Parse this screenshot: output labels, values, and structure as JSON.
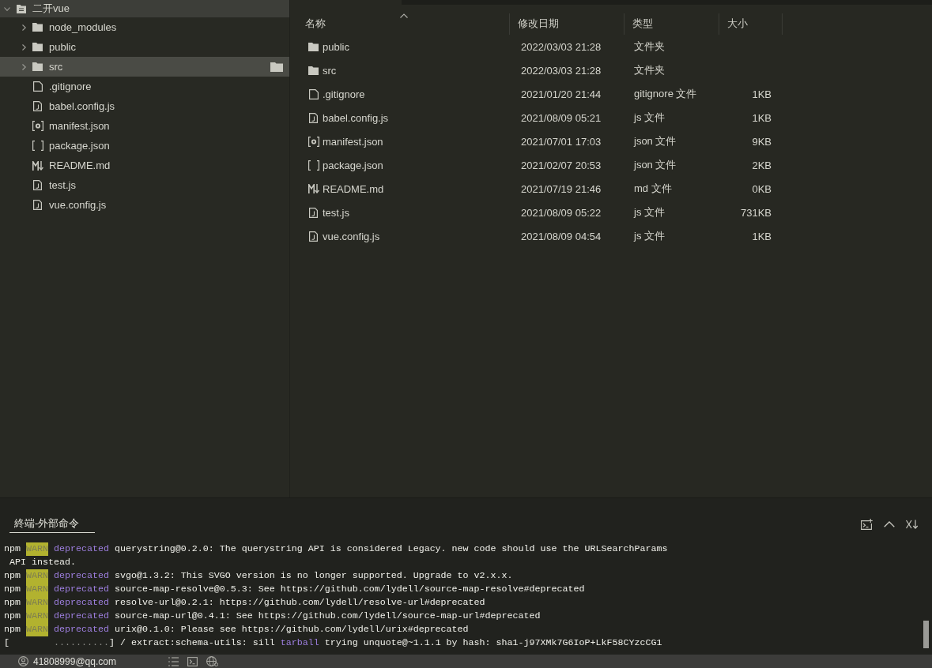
{
  "explorer": {
    "root": {
      "label": "二开vue",
      "expanded": true,
      "children": [
        {
          "name": "node_modules",
          "kind": "folder",
          "expanded": false,
          "selected": false
        },
        {
          "name": "public",
          "kind": "folder",
          "expanded": false,
          "selected": false
        },
        {
          "name": "src",
          "kind": "folder",
          "expanded": false,
          "selected": true
        },
        {
          "name": ".gitignore",
          "kind": "file",
          "selected": false
        },
        {
          "name": "babel.config.js",
          "kind": "script",
          "selected": false
        },
        {
          "name": "manifest.json",
          "kind": "settings",
          "selected": false
        },
        {
          "name": "package.json",
          "kind": "brackets",
          "selected": false
        },
        {
          "name": "README.md",
          "kind": "markdown",
          "selected": false
        },
        {
          "name": "test.js",
          "kind": "script",
          "selected": false
        },
        {
          "name": "vue.config.js",
          "kind": "script",
          "selected": false
        }
      ]
    }
  },
  "file_list": {
    "columns": [
      {
        "label": "名称",
        "sorted": true
      },
      {
        "label": "修改日期",
        "sorted": false
      },
      {
        "label": "类型",
        "sorted": false
      },
      {
        "label": "大小",
        "sorted": false
      }
    ],
    "rows": [
      {
        "name": "public",
        "kind": "folder",
        "modified": "2022/03/03 21:28",
        "type": "文件夹"
      },
      {
        "name": "src",
        "kind": "folder",
        "modified": "2022/03/03 21:28",
        "type": "文件夹"
      },
      {
        "name": ".gitignore",
        "kind": "file",
        "modified": "2021/01/20 21:44",
        "type": "gitignore 文件",
        "size": "1KB"
      },
      {
        "name": "babel.config.js",
        "kind": "script",
        "modified": "2021/08/09 05:21",
        "type": "js 文件",
        "size": "1KB"
      },
      {
        "name": "manifest.json",
        "kind": "settings",
        "modified": "2021/07/01 17:03",
        "type": "json 文件",
        "size": "9KB"
      },
      {
        "name": "package.json",
        "kind": "brackets",
        "modified": "2021/02/07 20:53",
        "type": "json 文件",
        "size": "2KB"
      },
      {
        "name": "README.md",
        "kind": "markdown",
        "modified": "2021/07/19 21:46",
        "type": "md 文件",
        "size": "0KB"
      },
      {
        "name": "test.js",
        "kind": "script",
        "modified": "2021/08/09 05:22",
        "type": "js 文件",
        "size": "731KB"
      },
      {
        "name": "vue.config.js",
        "kind": "script",
        "modified": "2021/08/09 04:54",
        "type": "js 文件",
        "size": "1KB"
      }
    ]
  },
  "terminal": {
    "tab": {
      "label": "終端-外部命令",
      "selected": true
    },
    "lines": [
      {
        "segments": [
          {
            "kind": "plain",
            "text": "npm "
          },
          {
            "kind": "badge",
            "text": "WARN"
          },
          {
            "kind": "keyword",
            "text": " deprecated"
          },
          {
            "kind": "plain",
            "text": " querystring@0.2.0: The querystring API is considered Legacy. new code should use the URLSearchParams"
          }
        ]
      },
      {
        "segments": [
          {
            "kind": "plain",
            "text": " API instead."
          }
        ]
      },
      {
        "segments": [
          {
            "kind": "plain",
            "text": "npm "
          },
          {
            "kind": "badge",
            "text": "WARN"
          },
          {
            "kind": "keyword",
            "text": " deprecated"
          },
          {
            "kind": "plain",
            "text": " svgo@1.3.2: This SVGO version is no longer supported. Upgrade to v2.x.x."
          }
        ]
      },
      {
        "segments": [
          {
            "kind": "plain",
            "text": "npm "
          },
          {
            "kind": "badge",
            "text": "WARN"
          },
          {
            "kind": "keyword",
            "text": " deprecated"
          },
          {
            "kind": "plain",
            "text": " source-map-resolve@0.5.3: See https://github.com/lydell/source-map-resolve#deprecated"
          }
        ]
      },
      {
        "segments": [
          {
            "kind": "plain",
            "text": "npm "
          },
          {
            "kind": "badge",
            "text": "WARN"
          },
          {
            "kind": "keyword",
            "text": " deprecated"
          },
          {
            "kind": "plain",
            "text": " resolve-url@0.2.1: https://github.com/lydell/resolve-url#deprecated"
          }
        ]
      },
      {
        "segments": [
          {
            "kind": "plain",
            "text": "npm "
          },
          {
            "kind": "badge",
            "text": "WARN"
          },
          {
            "kind": "keyword",
            "text": " deprecated"
          },
          {
            "kind": "plain",
            "text": " source-map-url@0.4.1: See https://github.com/lydell/source-map-url#deprecated"
          }
        ]
      },
      {
        "segments": [
          {
            "kind": "plain",
            "text": "npm "
          },
          {
            "kind": "badge",
            "text": "WARN"
          },
          {
            "kind": "keyword",
            "text": " deprecated"
          },
          {
            "kind": "plain",
            "text": " urix@0.1.0: Please see https://github.com/lydell/urix#deprecated"
          }
        ]
      },
      {
        "segments": [
          {
            "kind": "plain",
            "text": "["
          },
          {
            "kind": "dim",
            "text": "        .........."
          },
          {
            "kind": "plain",
            "text": "] / extract:schema-utils: sill "
          },
          {
            "kind": "keyword",
            "text": "tarball"
          },
          {
            "kind": "plain",
            "text": " trying unquote@~1.1.1 by hash: sha1-j97XMk7G6IoP+LkF58CYzcCG1"
          }
        ]
      }
    ]
  },
  "status_bar": {
    "account": "41808999@qq.com"
  }
}
